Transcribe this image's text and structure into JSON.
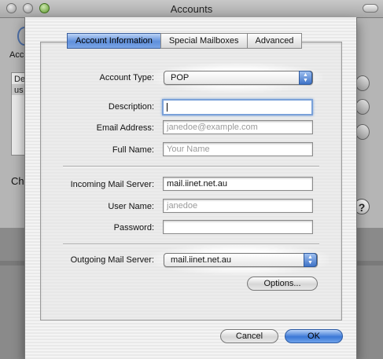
{
  "background_window": {
    "title": "Accounts",
    "toolbar_label": "Acc",
    "list_items": [
      "De",
      "us"
    ],
    "side_label": "Ch",
    "help_label": "?"
  },
  "sheet": {
    "tabs": [
      {
        "label": "Account Information",
        "active": true
      },
      {
        "label": "Special Mailboxes",
        "active": false
      },
      {
        "label": "Advanced",
        "active": false
      }
    ],
    "account_type": {
      "label": "Account Type:",
      "value": "POP"
    },
    "description": {
      "label": "Description:",
      "value": ""
    },
    "email_address": {
      "label": "Email Address:",
      "placeholder": "janedoe@example.com"
    },
    "full_name": {
      "label": "Full Name:",
      "placeholder": "Your Name"
    },
    "incoming_server": {
      "label": "Incoming Mail Server:",
      "value": "mail.iinet.net.au"
    },
    "user_name": {
      "label": "User Name:",
      "placeholder": "janedoe"
    },
    "password": {
      "label": "Password:",
      "value": ""
    },
    "outgoing_server": {
      "label": "Outgoing Mail Server:",
      "value": "mail.iinet.net.au"
    },
    "options_button": "Options...",
    "cancel_button": "Cancel",
    "ok_button": "OK"
  },
  "colors": {
    "accent_blue": "#5f8fdb",
    "focus_ring": "#7aa1d9"
  }
}
